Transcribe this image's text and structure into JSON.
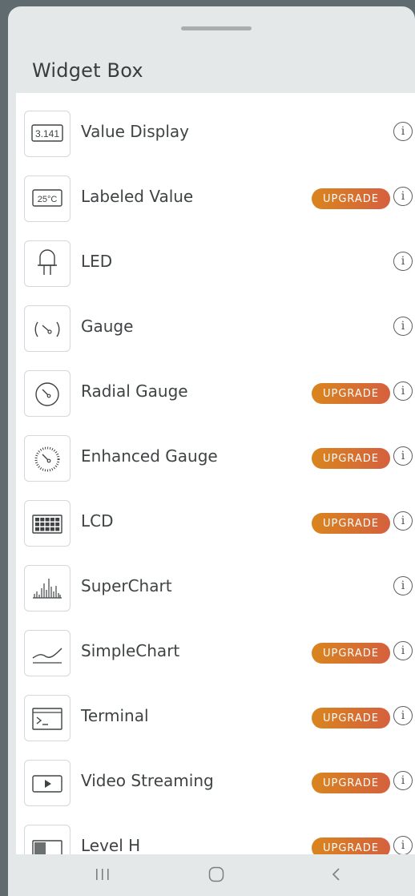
{
  "sheet": {
    "title": "Widget Box"
  },
  "upgrade_label": "UPGRADE",
  "info_glyph": "i",
  "widgets": [
    {
      "label": "Value Display",
      "icon": "value-display-icon",
      "upgrade": false
    },
    {
      "label": "Labeled Value",
      "icon": "labeled-value-icon",
      "upgrade": true
    },
    {
      "label": "LED",
      "icon": "led-icon",
      "upgrade": false
    },
    {
      "label": "Gauge",
      "icon": "gauge-icon",
      "upgrade": false
    },
    {
      "label": "Radial Gauge",
      "icon": "radial-gauge-icon",
      "upgrade": true
    },
    {
      "label": "Enhanced Gauge",
      "icon": "enhanced-gauge-icon",
      "upgrade": true
    },
    {
      "label": "LCD",
      "icon": "lcd-icon",
      "upgrade": true
    },
    {
      "label": "SuperChart",
      "icon": "superchart-icon",
      "upgrade": false
    },
    {
      "label": "SimpleChart",
      "icon": "simplechart-icon",
      "upgrade": true
    },
    {
      "label": "Terminal",
      "icon": "terminal-icon",
      "upgrade": true
    },
    {
      "label": "Video Streaming",
      "icon": "video-streaming-icon",
      "upgrade": true
    },
    {
      "label": "Level H",
      "icon": "level-h-icon",
      "upgrade": true
    }
  ],
  "icon_text": {
    "value_display": "3.141",
    "labeled_value": "25°C"
  },
  "nav": {
    "recents_icon": "recents-icon",
    "home_icon": "home-icon",
    "back_icon": "back-icon"
  },
  "colors": {
    "badge_start": "#d9851e",
    "badge_end": "#d5603e",
    "sheet_bg": "#e4e8e8",
    "list_bg": "#ffffff"
  }
}
